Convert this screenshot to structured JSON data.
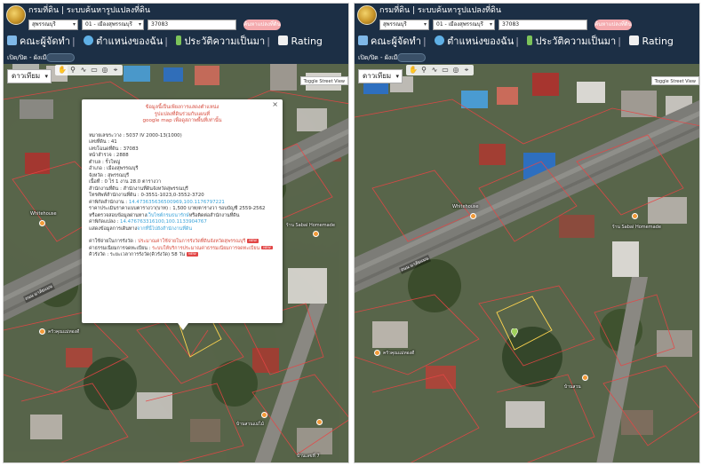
{
  "app": {
    "title": "กรมที่ดิน | ระบบค้นหารูปแปลงที่ดิน"
  },
  "search": {
    "province": "สุพรรณบุรี",
    "district": "01 - เมืองสุพรรณบุรี",
    "parcel_number": "37083",
    "button_label": "ค้นหาแปลงที่ดิน"
  },
  "nav": {
    "items": [
      {
        "label": "คณะผู้จัดทำ",
        "icon": "bookshelf-icon"
      },
      {
        "label": "ตำแหน่งของฉัน",
        "icon": "globe-icon"
      },
      {
        "label": "ประวัติความเป็นมา",
        "icon": "sprout-icon"
      },
      {
        "label": "Rating",
        "icon": "chart-icon"
      }
    ]
  },
  "layer_toggle": {
    "label": "เปิด/ปิด - ผังเมือง"
  },
  "map": {
    "maptype": "ดาวเทียม",
    "street_view": "Toggle Street View",
    "road_labels": [
      "ถนน มาลัยแมน",
      "ถนน มาลัยแมน"
    ],
    "poi_labels": [
      "Whitehouse",
      "ร้าน Sabai Homemade",
      "บ้านสวนแม่ไม้",
      "ครัวคุณแม่ทองดี",
      "บ้านเลขที่ 7",
      "Whitehouse",
      "ร้าน Sabai Homemade",
      "บ้านสวน",
      "ครัวคุณแม่ทองดี"
    ]
  },
  "popup": {
    "warning": [
      "ข้อมูลนี้เป็นเพียงการแสดงตำแหน่ง",
      "รูปแปลงที่ดินร่วมกับแผนที่",
      "google map เพื่อดูสภาพพื้นที่เท่านั้น"
    ],
    "rows": [
      "หมายเลขระวาง : 5037 IV 2000-13(1000)",
      "เลขที่ดิน : 41",
      "เลขโฉนดที่ดิน : 37083",
      "หน้าสำรวจ : 2888",
      "ตำบล : รั้วใหญ่",
      "อำเภอ : เมืองสุพรรณบุรี",
      "จังหวัด : สุพรรณบุรี",
      "เนื้อที่ : 0 ไร่ 1 งาน 28.0 ตารางวา",
      "สำนักงานที่ดิน : สำนักงานที่ดินจังหวัดสุพรรณบุรี",
      "โทรศัพท์สำนักงานที่ดิน : 0-3551-1023,0-3552-3720"
    ],
    "coords_label": "ค่าพิกัดสำนักงาน :",
    "coords_value": "14.473635636500969,100.1176797221",
    "price_row": "ราคาประเมินราคาแบบตารางวา(บาท) : 1,500 บาท/ตารางวา รอบบัญชี 2559-2562",
    "price_check_prefix": "หรือตรวจสอบข้อมูลผ่านทาง",
    "price_check_link": "เว็บไซต์กรมธนารักษ์",
    "price_check_suffix": "หรือติดต่อสำนักงานที่ดิน",
    "parcel_coords_label": "ค่าพิกัดแปลง :",
    "parcel_coords_value": "14.476763316100,100.1133904767",
    "route_prefix": "แสดงข้อมูลการเดินทาง",
    "route_link": "จากที่นี่ไปยังสำนักงานที่ดิน",
    "fee_label": "ค่าใช้จ่ายในการรังวัด :",
    "fee_link": "ประมาณค่าใช้จ่ายในการรังวัดที่ดินจังหวัดสุพรรณบุรี",
    "service_label": "ค่าธรรมเนียมการจดทะเบียน :",
    "service_link": "ระบบให้บริการประมาณค่าธรรมเนียมการจดทะเบียน",
    "queue_label": "คิวรังวัด : ระยะเวลาการรังวัด(คิวรังวัด) 58 วัน",
    "badge": "NEW"
  }
}
